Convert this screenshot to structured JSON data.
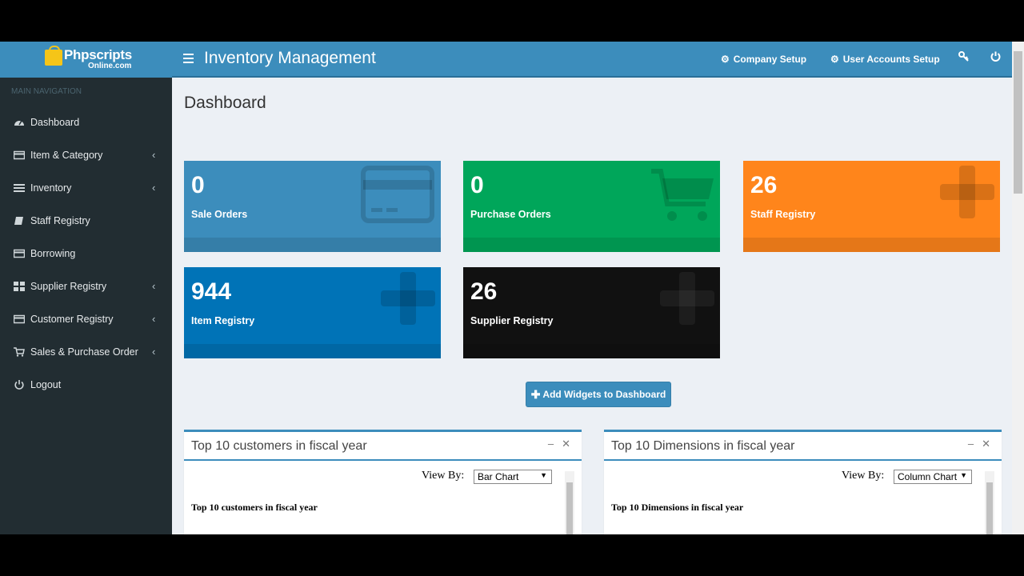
{
  "header": {
    "logo_text": "Phpscripts",
    "logo_sub": "Online.com",
    "app_title": "Inventory Management",
    "links": [
      "Company Setup",
      "User Accounts Setup"
    ]
  },
  "sidebar": {
    "header": "MAIN NAVIGATION",
    "items": [
      {
        "label": "Dashboard",
        "icon": "dashboard-icon",
        "caret": false
      },
      {
        "label": "Item & Category",
        "icon": "card-icon",
        "caret": true
      },
      {
        "label": "Inventory",
        "icon": "list-icon",
        "caret": true
      },
      {
        "label": "Staff Registry",
        "icon": "book-icon",
        "caret": false
      },
      {
        "label": "Borrowing",
        "icon": "card-icon",
        "caret": false
      },
      {
        "label": "Supplier Registry",
        "icon": "grid-icon",
        "caret": true
      },
      {
        "label": "Customer Registry",
        "icon": "card-icon",
        "caret": true
      },
      {
        "label": "Sales & Purchase Order",
        "icon": "cart-icon",
        "caret": true
      },
      {
        "label": "Logout",
        "icon": "power-icon",
        "caret": false
      }
    ]
  },
  "main": {
    "page_title": "Dashboard",
    "stat_boxes": [
      {
        "value": "0",
        "label": "Sale Orders",
        "color": "#3c8dbc"
      },
      {
        "value": "0",
        "label": "Purchase Orders",
        "color": "#00a65a"
      },
      {
        "value": "26",
        "label": "Staff Registry",
        "color": "#ff851b"
      },
      {
        "value": "944",
        "label": "Item Registry",
        "color": "#0073b7"
      },
      {
        "value": "26",
        "label": "Supplier Registry",
        "color": "#111111"
      }
    ],
    "add_widgets_label": "Add Widgets to Dashboard",
    "panels": [
      {
        "title": "Top 10 customers in fiscal year",
        "view_by_label": "View By:",
        "view_by_value": "Bar Chart",
        "chart_title": "Top 10 customers in fiscal year"
      },
      {
        "title": "Top 10 Dimensions in fiscal year",
        "view_by_label": "View By:",
        "view_by_value": "Column Chart",
        "chart_title": "Top 10 Dimensions in fiscal year"
      }
    ]
  }
}
